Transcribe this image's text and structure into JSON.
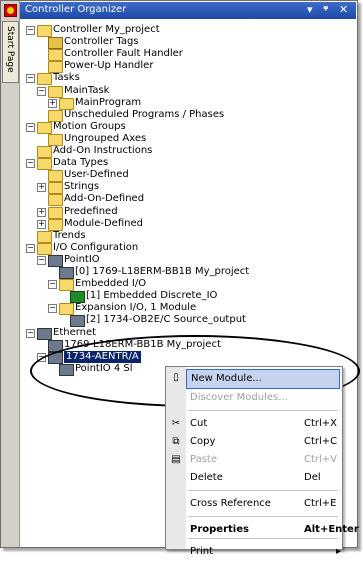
{
  "side": {
    "tab_label": "Start Page"
  },
  "panel": {
    "title": "Controller Organizer",
    "ctl_dropdown": "▾",
    "ctl_pin": "ᵠ",
    "ctl_close": "✕"
  },
  "tree": [
    {
      "label": "Controller My_project",
      "indent": 0,
      "exp": "-",
      "icon": "folder"
    },
    {
      "label": "Controller Tags",
      "indent": 1,
      "exp": "",
      "icon": "tag"
    },
    {
      "label": "Controller Fault Handler",
      "indent": 1,
      "exp": "",
      "icon": "folder"
    },
    {
      "label": "Power-Up Handler",
      "indent": 1,
      "exp": "",
      "icon": "folder"
    },
    {
      "label": "Tasks",
      "indent": 0,
      "exp": "-",
      "icon": "folder"
    },
    {
      "label": "MainTask",
      "indent": 1,
      "exp": "-",
      "icon": "folder"
    },
    {
      "label": "MainProgram",
      "indent": 2,
      "exp": "+",
      "icon": "folder"
    },
    {
      "label": "Unscheduled Programs / Phases",
      "indent": 1,
      "exp": "",
      "icon": "folder"
    },
    {
      "label": "Motion Groups",
      "indent": 0,
      "exp": "-",
      "icon": "folder"
    },
    {
      "label": "Ungrouped Axes",
      "indent": 1,
      "exp": "",
      "icon": "folder"
    },
    {
      "label": "Add-On Instructions",
      "indent": 0,
      "exp": "",
      "icon": "folder"
    },
    {
      "label": "Data Types",
      "indent": 0,
      "exp": "-",
      "icon": "folder"
    },
    {
      "label": "User-Defined",
      "indent": 1,
      "exp": "",
      "icon": "folder"
    },
    {
      "label": "Strings",
      "indent": 1,
      "exp": "+",
      "icon": "folder"
    },
    {
      "label": "Add-On-Defined",
      "indent": 1,
      "exp": "",
      "icon": "folder"
    },
    {
      "label": "Predefined",
      "indent": 1,
      "exp": "+",
      "icon": "folder"
    },
    {
      "label": "Module-Defined",
      "indent": 1,
      "exp": "+",
      "icon": "folder"
    },
    {
      "label": "Trends",
      "indent": 0,
      "exp": "",
      "icon": "folder"
    },
    {
      "label": "I/O Configuration",
      "indent": 0,
      "exp": "-",
      "icon": "folder"
    },
    {
      "label": "PointIO",
      "indent": 1,
      "exp": "-",
      "icon": "mod"
    },
    {
      "label": "[0] 1769-L18ERM-BB1B My_project",
      "indent": 2,
      "exp": "",
      "icon": "mod"
    },
    {
      "label": "Embedded I/O",
      "indent": 2,
      "exp": "-",
      "icon": "folder"
    },
    {
      "label": "[1] Embedded Discrete_IO",
      "indent": 3,
      "exp": "",
      "icon": "green"
    },
    {
      "label": "Expansion I/O, 1 Module",
      "indent": 2,
      "exp": "-",
      "icon": "folder"
    },
    {
      "label": "[2] 1734-OB2E/C Source_output",
      "indent": 3,
      "exp": "",
      "icon": "mod"
    },
    {
      "label": "Ethernet",
      "indent": 0,
      "exp": "-",
      "icon": "mod"
    },
    {
      "label": "1769-L18ERM-BB1B My_project",
      "indent": 1,
      "exp": "",
      "icon": "mod"
    },
    {
      "label": "1734-AENTR/A",
      "indent": 1,
      "exp": "-",
      "icon": "mod",
      "selected": true
    },
    {
      "label": "PointIO 4 Sl",
      "indent": 2,
      "exp": "",
      "icon": "mod"
    }
  ],
  "menu": {
    "items": [
      {
        "label": "New Module...",
        "shortcut": "",
        "icon": "new-module-icon",
        "glyph": "▯",
        "state": "hl"
      },
      {
        "label": "Discover Modules...",
        "shortcut": "",
        "icon": "",
        "glyph": "",
        "state": "dis"
      },
      {
        "label": "Cut",
        "shortcut": "Ctrl+X",
        "icon": "cut-icon",
        "glyph": "✂",
        "state": ""
      },
      {
        "label": "Copy",
        "shortcut": "Ctrl+C",
        "icon": "copy-icon",
        "glyph": "⧉",
        "state": ""
      },
      {
        "label": "Paste",
        "shortcut": "Ctrl+V",
        "icon": "paste-icon",
        "glyph": "▤",
        "state": "dis"
      },
      {
        "label": "Delete",
        "shortcut": "Del",
        "icon": "",
        "glyph": "",
        "state": ""
      },
      {
        "label": "Cross Reference",
        "shortcut": "Ctrl+E",
        "icon": "",
        "glyph": "",
        "state": ""
      },
      {
        "label": "Properties",
        "shortcut": "Alt+Enter",
        "icon": "",
        "glyph": "",
        "state": "bold"
      },
      {
        "label": "Print",
        "shortcut": "▸",
        "icon": "",
        "glyph": "",
        "state": ""
      }
    ]
  }
}
